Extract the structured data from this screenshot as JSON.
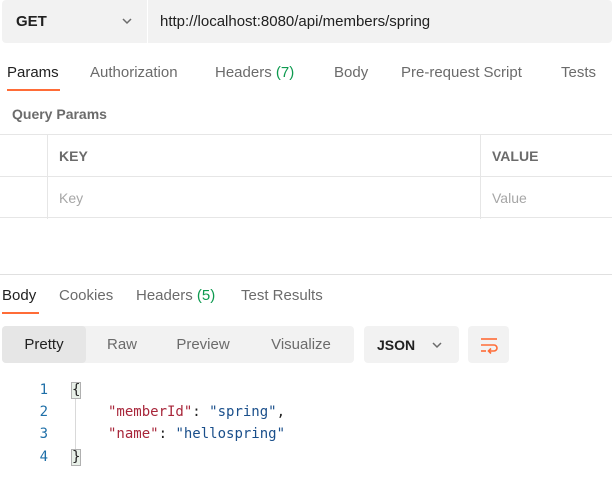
{
  "request": {
    "method": "GET",
    "url": "http://localhost:8080/api/members/spring"
  },
  "request_tabs": [
    {
      "label": "Params",
      "count": ""
    },
    {
      "label": "Authorization",
      "count": ""
    },
    {
      "label": "Headers",
      "count": "(7)"
    },
    {
      "label": "Body",
      "count": ""
    },
    {
      "label": "Pre-request Script",
      "count": ""
    },
    {
      "label": "Tests",
      "count": ""
    }
  ],
  "query_params": {
    "title": "Query Params",
    "columns": [
      "KEY",
      "VALUE"
    ],
    "key_placeholder": "Key",
    "value_placeholder": "Value"
  },
  "response_tabs": [
    {
      "label": "Body",
      "count": ""
    },
    {
      "label": "Cookies",
      "count": ""
    },
    {
      "label": "Headers",
      "count": "(5)"
    },
    {
      "label": "Test Results",
      "count": ""
    }
  ],
  "view_modes": [
    "Pretty",
    "Raw",
    "Preview",
    "Visualize"
  ],
  "format": "JSON",
  "code": {
    "line_numbers": [
      "1",
      "2",
      "3",
      "4"
    ],
    "open_brace": "{",
    "close_brace": "}",
    "fields": [
      {
        "key": "\"memberId\"",
        "value": "\"spring\"",
        "trail": ","
      },
      {
        "key": "\"name\"",
        "value": "\"hellospring\"",
        "trail": ""
      }
    ]
  },
  "colors": {
    "accent": "#ff6c37",
    "count_green": "#0d9a4f",
    "json_key": "#a8263a",
    "json_string": "#1a4f8b"
  }
}
